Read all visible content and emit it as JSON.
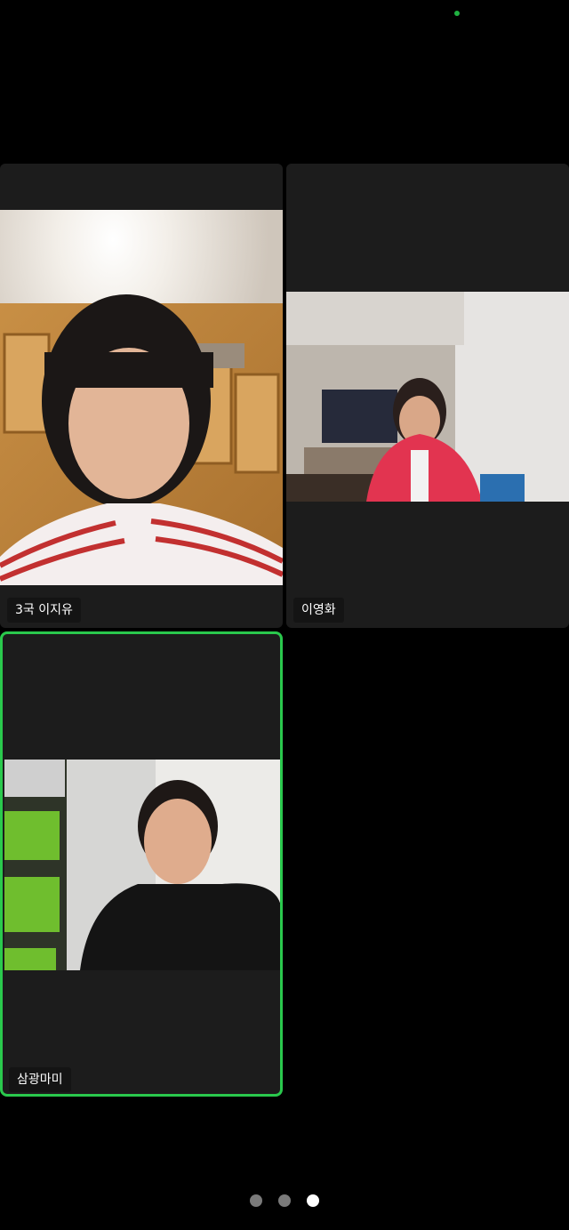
{
  "status": {
    "indicator_color": "#1fb141"
  },
  "participants": [
    {
      "name": "3국 이지유",
      "active_speaker": false
    },
    {
      "name": "이영화",
      "active_speaker": false
    },
    {
      "name": "삼광마미",
      "active_speaker": true
    }
  ],
  "pager": {
    "pages": 3,
    "current_page": 3
  },
  "colors": {
    "active_border": "#2ac94d",
    "tile_background": "#1c1c1c"
  }
}
